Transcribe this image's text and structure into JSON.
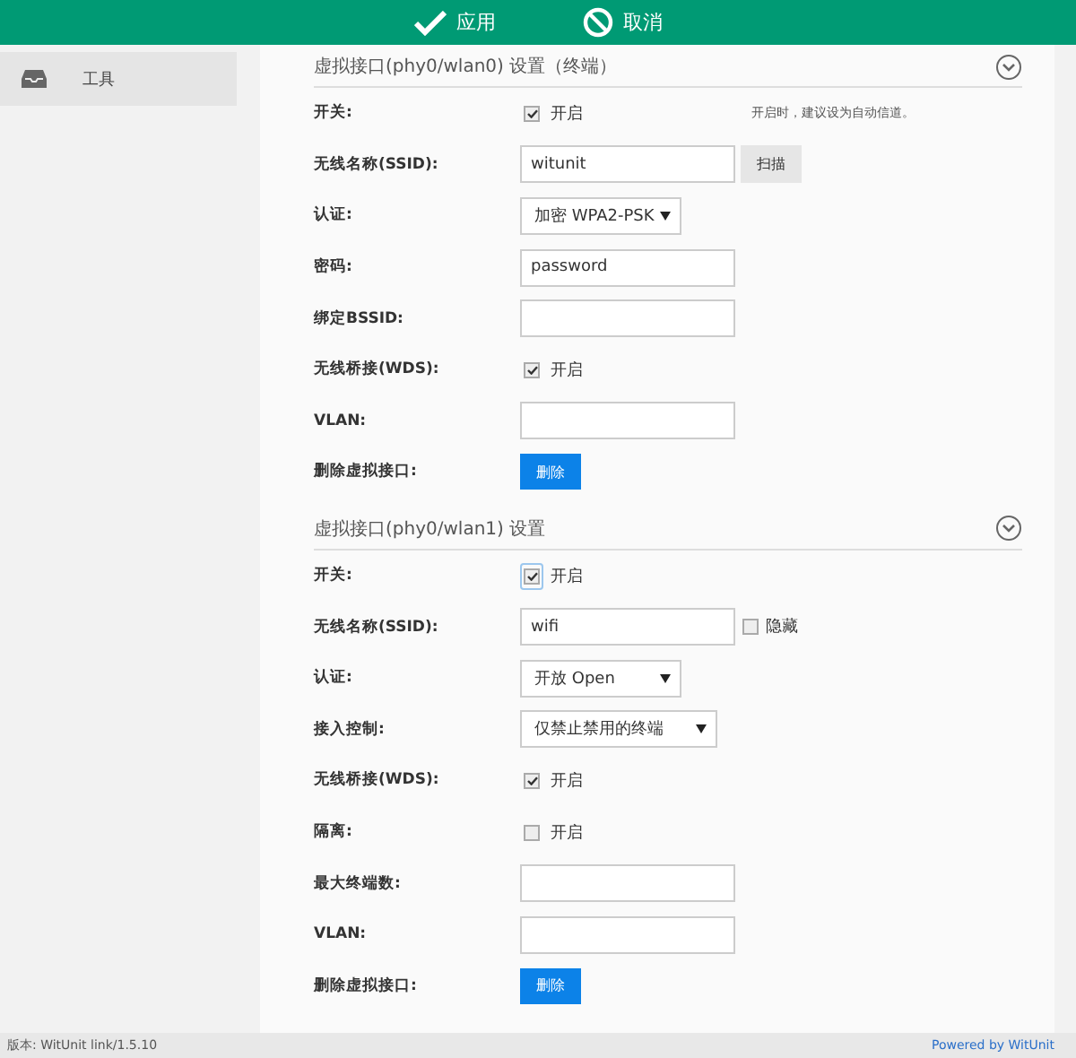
{
  "toolbar": {
    "buttons": [
      {
        "kind": "apply",
        "label": "应用"
      },
      {
        "kind": "cancel",
        "label": "取消"
      }
    ]
  },
  "sidebar": {
    "items": [
      {
        "label": "工具",
        "selected": true
      }
    ]
  },
  "sections": [
    {
      "title": "虚拟接口(phy0/wlan0) 设置（终端）",
      "rows": [
        {
          "kind": "checkbox",
          "label": "开关:",
          "option": "开启",
          "checked": true,
          "focused": false,
          "note": "开启时，建议设为自动信道。"
        },
        {
          "kind": "text",
          "label": "无线名称(SSID):",
          "value": "witunit",
          "button": "扫描"
        },
        {
          "kind": "select",
          "label": "认证:",
          "value": "加密 WPA2-PSK",
          "wide": false
        },
        {
          "kind": "text",
          "label": "密码:",
          "value": "password"
        },
        {
          "kind": "text",
          "label": "绑定BSSID:"
        },
        {
          "kind": "checkbox",
          "label": "无线桥接(WDS):",
          "option": "开启",
          "checked": true,
          "focused": false
        },
        {
          "kind": "text",
          "label": "VLAN:"
        },
        {
          "kind": "button",
          "label": "删除虚拟接口:",
          "button": "删除"
        }
      ]
    },
    {
      "title": "虚拟接口(phy0/wlan1) 设置",
      "rows": [
        {
          "kind": "checkbox",
          "label": "开关:",
          "option": "开启",
          "checked": true,
          "focused": true
        },
        {
          "kind": "text",
          "label": "无线名称(SSID):",
          "value": "wifi",
          "extra": {
            "label": "隐藏",
            "checked": false
          }
        },
        {
          "kind": "select",
          "label": "认证:",
          "value": "开放 Open",
          "wide": false
        },
        {
          "kind": "select",
          "label": "接入控制:",
          "value": "仅禁止禁用的终端",
          "wide": true
        },
        {
          "kind": "checkbox",
          "label": "无线桥接(WDS):",
          "option": "开启",
          "checked": true,
          "focused": false
        },
        {
          "kind": "checkbox",
          "label": "隔离:",
          "option": "开启",
          "checked": false,
          "focused": false
        },
        {
          "kind": "text",
          "label": "最大终端数:"
        },
        {
          "kind": "text",
          "label": "VLAN:"
        },
        {
          "kind": "button",
          "label": "删除虚拟接口:",
          "button": "删除"
        }
      ]
    }
  ],
  "footer": {
    "version": "版本: WitUnit link/1.5.10",
    "powered": "Powered by WitUnit"
  }
}
